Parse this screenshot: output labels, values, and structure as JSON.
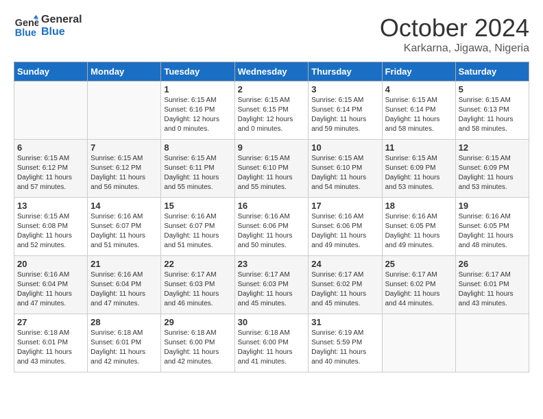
{
  "logo": {
    "line1": "General",
    "line2": "Blue"
  },
  "title": "October 2024",
  "subtitle": "Karkarna, Jigawa, Nigeria",
  "days_of_week": [
    "Sunday",
    "Monday",
    "Tuesday",
    "Wednesday",
    "Thursday",
    "Friday",
    "Saturday"
  ],
  "weeks": [
    [
      {
        "day": "",
        "info": ""
      },
      {
        "day": "",
        "info": ""
      },
      {
        "day": "1",
        "info": "Sunrise: 6:15 AM\nSunset: 6:16 PM\nDaylight: 12 hours\nand 0 minutes."
      },
      {
        "day": "2",
        "info": "Sunrise: 6:15 AM\nSunset: 6:15 PM\nDaylight: 12 hours\nand 0 minutes."
      },
      {
        "day": "3",
        "info": "Sunrise: 6:15 AM\nSunset: 6:14 PM\nDaylight: 11 hours\nand 59 minutes."
      },
      {
        "day": "4",
        "info": "Sunrise: 6:15 AM\nSunset: 6:14 PM\nDaylight: 11 hours\nand 58 minutes."
      },
      {
        "day": "5",
        "info": "Sunrise: 6:15 AM\nSunset: 6:13 PM\nDaylight: 11 hours\nand 58 minutes."
      }
    ],
    [
      {
        "day": "6",
        "info": "Sunrise: 6:15 AM\nSunset: 6:12 PM\nDaylight: 11 hours\nand 57 minutes."
      },
      {
        "day": "7",
        "info": "Sunrise: 6:15 AM\nSunset: 6:12 PM\nDaylight: 11 hours\nand 56 minutes."
      },
      {
        "day": "8",
        "info": "Sunrise: 6:15 AM\nSunset: 6:11 PM\nDaylight: 11 hours\nand 55 minutes."
      },
      {
        "day": "9",
        "info": "Sunrise: 6:15 AM\nSunset: 6:10 PM\nDaylight: 11 hours\nand 55 minutes."
      },
      {
        "day": "10",
        "info": "Sunrise: 6:15 AM\nSunset: 6:10 PM\nDaylight: 11 hours\nand 54 minutes."
      },
      {
        "day": "11",
        "info": "Sunrise: 6:15 AM\nSunset: 6:09 PM\nDaylight: 11 hours\nand 53 minutes."
      },
      {
        "day": "12",
        "info": "Sunrise: 6:15 AM\nSunset: 6:09 PM\nDaylight: 11 hours\nand 53 minutes."
      }
    ],
    [
      {
        "day": "13",
        "info": "Sunrise: 6:15 AM\nSunset: 6:08 PM\nDaylight: 11 hours\nand 52 minutes."
      },
      {
        "day": "14",
        "info": "Sunrise: 6:16 AM\nSunset: 6:07 PM\nDaylight: 11 hours\nand 51 minutes."
      },
      {
        "day": "15",
        "info": "Sunrise: 6:16 AM\nSunset: 6:07 PM\nDaylight: 11 hours\nand 51 minutes."
      },
      {
        "day": "16",
        "info": "Sunrise: 6:16 AM\nSunset: 6:06 PM\nDaylight: 11 hours\nand 50 minutes."
      },
      {
        "day": "17",
        "info": "Sunrise: 6:16 AM\nSunset: 6:06 PM\nDaylight: 11 hours\nand 49 minutes."
      },
      {
        "day": "18",
        "info": "Sunrise: 6:16 AM\nSunset: 6:05 PM\nDaylight: 11 hours\nand 49 minutes."
      },
      {
        "day": "19",
        "info": "Sunrise: 6:16 AM\nSunset: 6:05 PM\nDaylight: 11 hours\nand 48 minutes."
      }
    ],
    [
      {
        "day": "20",
        "info": "Sunrise: 6:16 AM\nSunset: 6:04 PM\nDaylight: 11 hours\nand 47 minutes."
      },
      {
        "day": "21",
        "info": "Sunrise: 6:16 AM\nSunset: 6:04 PM\nDaylight: 11 hours\nand 47 minutes."
      },
      {
        "day": "22",
        "info": "Sunrise: 6:17 AM\nSunset: 6:03 PM\nDaylight: 11 hours\nand 46 minutes."
      },
      {
        "day": "23",
        "info": "Sunrise: 6:17 AM\nSunset: 6:03 PM\nDaylight: 11 hours\nand 45 minutes."
      },
      {
        "day": "24",
        "info": "Sunrise: 6:17 AM\nSunset: 6:02 PM\nDaylight: 11 hours\nand 45 minutes."
      },
      {
        "day": "25",
        "info": "Sunrise: 6:17 AM\nSunset: 6:02 PM\nDaylight: 11 hours\nand 44 minutes."
      },
      {
        "day": "26",
        "info": "Sunrise: 6:17 AM\nSunset: 6:01 PM\nDaylight: 11 hours\nand 43 minutes."
      }
    ],
    [
      {
        "day": "27",
        "info": "Sunrise: 6:18 AM\nSunset: 6:01 PM\nDaylight: 11 hours\nand 43 minutes."
      },
      {
        "day": "28",
        "info": "Sunrise: 6:18 AM\nSunset: 6:01 PM\nDaylight: 11 hours\nand 42 minutes."
      },
      {
        "day": "29",
        "info": "Sunrise: 6:18 AM\nSunset: 6:00 PM\nDaylight: 11 hours\nand 42 minutes."
      },
      {
        "day": "30",
        "info": "Sunrise: 6:18 AM\nSunset: 6:00 PM\nDaylight: 11 hours\nand 41 minutes."
      },
      {
        "day": "31",
        "info": "Sunrise: 6:19 AM\nSunset: 5:59 PM\nDaylight: 11 hours\nand 40 minutes."
      },
      {
        "day": "",
        "info": ""
      },
      {
        "day": "",
        "info": ""
      }
    ]
  ]
}
